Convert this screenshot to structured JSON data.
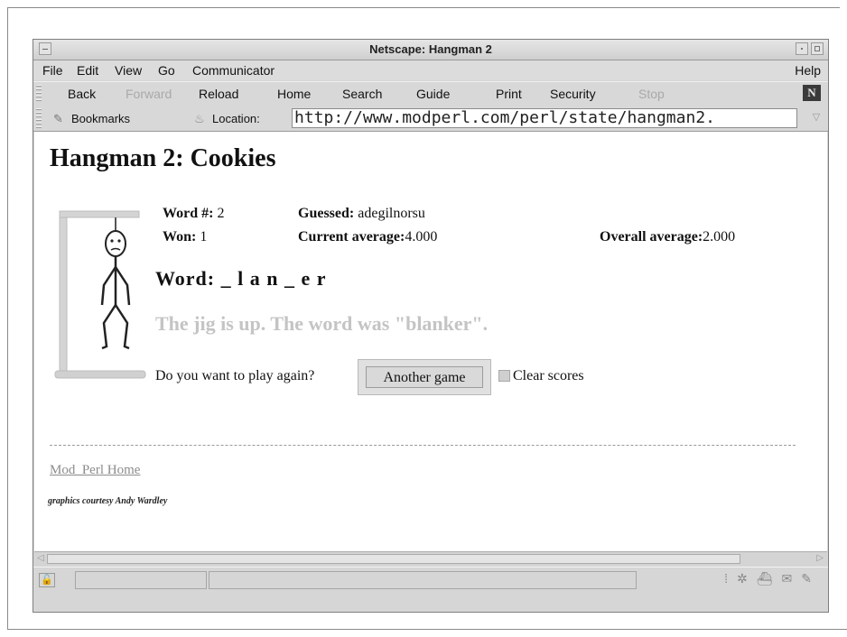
{
  "window": {
    "title": "Netscape: Hangman 2"
  },
  "menubar": {
    "file": "File",
    "edit": "Edit",
    "view": "View",
    "go": "Go",
    "communicator": "Communicator",
    "help": "Help"
  },
  "toolbar": {
    "back": "Back",
    "forward": "Forward",
    "reload": "Reload",
    "home": "Home",
    "search": "Search",
    "guide": "Guide",
    "print": "Print",
    "security": "Security",
    "stop": "Stop",
    "logo": "N"
  },
  "location": {
    "bookmarks": "Bookmarks",
    "label": "Location:",
    "url": "http://www.modperl.com/perl/state/hangman2."
  },
  "page": {
    "title": "Hangman 2: Cookies",
    "word_num_label": "Word #:",
    "word_num": "2",
    "guessed_label": "Guessed:",
    "guessed": "adegilnorsu",
    "won_label": "Won:",
    "won": "1",
    "current_avg_label": "Current average:",
    "current_avg": "4.000",
    "overall_avg_label": "Overall average:",
    "overall_avg": "2.000",
    "word_label": "Word:",
    "word": "_ l a n _ e r",
    "jig_text": "The jig is up. The word was \"blanker\".",
    "play_again": "Do you want to play again?",
    "another_game": "Another game",
    "clear_scores": "Clear scores",
    "home_link": "Mod_Perl Home",
    "credit": "graphics courtesy Andy Wardley"
  }
}
